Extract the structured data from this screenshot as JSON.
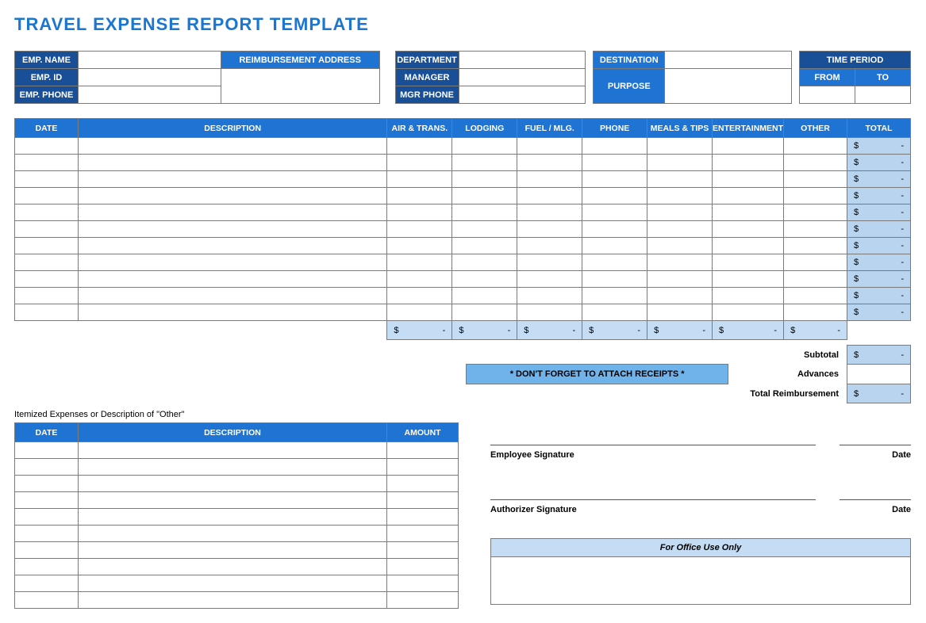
{
  "title": "TRAVEL EXPENSE REPORT TEMPLATE",
  "header": {
    "emp_name": "EMP. NAME",
    "emp_id": "EMP. ID",
    "emp_phone": "EMP. PHONE",
    "reimb_addr": "REIMBURSEMENT ADDRESS",
    "department": "DEPARTMENT",
    "manager": "MANAGER",
    "mgr_phone": "MGR PHONE",
    "destination": "DESTINATION",
    "purpose": "PURPOSE",
    "time_period": "TIME PERIOD",
    "from": "FROM",
    "to": "TO"
  },
  "expense_cols": {
    "date": "DATE",
    "desc": "DESCRIPTION",
    "air": "AIR & TRANS.",
    "lodging": "LODGING",
    "fuel": "FUEL / MLG.",
    "phone": "PHONE",
    "meals": "MEALS & TIPS",
    "ent": "ENTERTAINMENT",
    "other": "OTHER",
    "total": "TOTAL"
  },
  "dollar": "$",
  "dash": "-",
  "receipts_note": "* DON'T FORGET TO ATTACH RECEIPTS *",
  "summary": {
    "subtotal": "Subtotal",
    "advances": "Advances",
    "total_reimb": "Total Reimbursement"
  },
  "itemized_label": "Itemized Expenses or Description of \"Other\"",
  "item_cols": {
    "date": "DATE",
    "desc": "DESCRIPTION",
    "amount": "AMOUNT"
  },
  "sig": {
    "emp": "Employee Signature",
    "auth": "Authorizer Signature",
    "date": "Date"
  },
  "office": "For Office Use Only"
}
